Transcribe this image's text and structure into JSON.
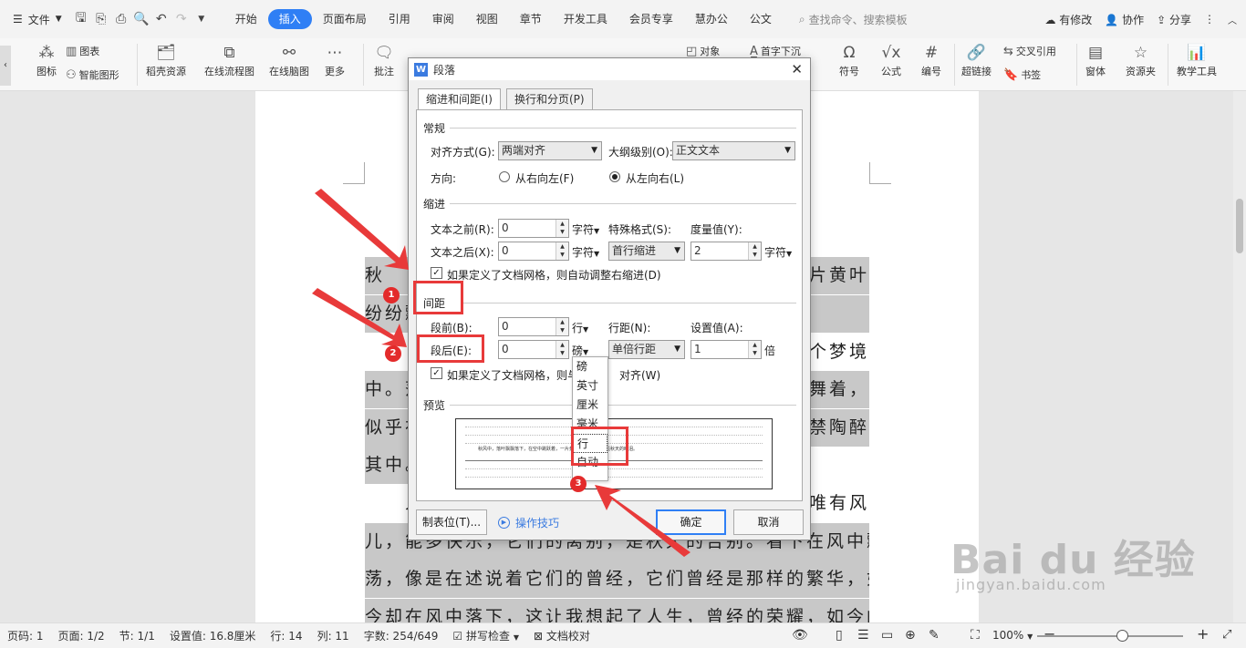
{
  "menubar": {
    "file": "文件",
    "tabs": [
      "开始",
      "插入",
      "页面布局",
      "引用",
      "审阅",
      "视图",
      "章节",
      "开发工具",
      "会员专享",
      "慧办公",
      "公文"
    ],
    "active_tab": "插入",
    "search": "查找命令、搜索模板",
    "right": {
      "revise": "有修改",
      "collab": "协作",
      "share": "分享"
    }
  },
  "ribbon": {
    "chart": "图表",
    "icon": "图标",
    "smart_graphic": "智能图形",
    "shell_resources": "稻壳资源",
    "online_flowchart": "在线流程图",
    "online_mindmap": "在线脑图",
    "more": "更多",
    "comment": "批注",
    "object": "对象",
    "dropcap": "首字下沉",
    "symbol": "符号",
    "formula": "公式",
    "numbering": "编号",
    "hyperlink": "超链接",
    "cross_ref": "交叉引用",
    "bookmark": "书签",
    "window": "窗体",
    "resource_folder": "资源夹",
    "teaching_tools": "教学工具"
  },
  "document": {
    "lines": [
      {
        "left": "秋",
        "right": "片黄叶"
      },
      {
        "left": "纷纷飘",
        "right": ""
      },
      {
        "left": "",
        "right": "个梦境"
      },
      {
        "left": "中。落",
        "right": "飞舞着，"
      },
      {
        "left": "似乎在",
        "right": "禁陶醉"
      },
      {
        "left": "其中。",
        "right": ""
      },
      {
        "left": "　　人",
        "right": "唯有风"
      },
      {
        "left": "儿，能多快乐，它们的离别，是秋天的告别。看下在风中飘",
        "right": ""
      },
      {
        "left": "荡，像是在述说着它们的曾经，它们曾经是那样的繁华，如",
        "right": ""
      },
      {
        "left": "今却在风中落下，这让我想起了人生，曾经的荣耀，如今的",
        "right": ""
      }
    ]
  },
  "dialog": {
    "title": "段落",
    "tabs": [
      "缩进和间距(I)",
      "换行和分页(P)"
    ],
    "general": {
      "section": "常规",
      "align_label": "对齐方式(G):",
      "align_value": "两端对齐",
      "outline_label": "大纲级别(O):",
      "outline_value": "正文文本",
      "direction_label": "方向:",
      "rtl": "从右向左(F)",
      "ltr": "从左向右(L)"
    },
    "indent": {
      "section": "缩进",
      "before_label": "文本之前(R):",
      "before_value": "0",
      "before_unit": "字符",
      "after_label": "文本之后(X):",
      "after_value": "0",
      "after_unit": "字符",
      "special_label": "特殊格式(S):",
      "special_value": "首行缩进",
      "measure_label": "度量值(Y):",
      "measure_value": "2",
      "measure_unit": "字符",
      "auto_adjust": "如果定义了文档网格，则自动调整右缩进(D)"
    },
    "spacing": {
      "section": "间距",
      "before_label": "段前(B):",
      "before_value": "0",
      "before_unit": "行",
      "after_label": "段后(E):",
      "after_value": "0",
      "after_unit": "磅",
      "line_label": "行距(N):",
      "line_value": "单倍行距",
      "setting_label": "设置值(A):",
      "setting_value": "1",
      "setting_unit": "倍",
      "grid_align_a": "如果定义了文档网格，则与",
      "grid_align_b": "对齐(W)"
    },
    "preview": {
      "section": "预览",
      "sample": "秋风中，落叶飘飘落下，在空中跳跃着，一片黄叶纷纷飘落，像是秋天的眼泪。"
    },
    "buttons": {
      "tabs": "制表位(T)...",
      "tips": "操作技巧",
      "ok": "确定",
      "cancel": "取消"
    }
  },
  "unit_menu": [
    "磅",
    "英寸",
    "厘米",
    "毫米",
    "行",
    "自动"
  ],
  "annotations": [
    "1",
    "2",
    "3"
  ],
  "watermark": {
    "brand": "Bai du 经验",
    "url": "jingyan.baidu.com"
  },
  "statusbar": {
    "page_no": "页码: 1",
    "pages": "页面: 1/2",
    "section": "节: 1/1",
    "setting": "设置值: 16.8厘米",
    "row": "行: 14",
    "col": "列: 11",
    "words": "字数: 254/649",
    "spell": "拼写检查",
    "proof": "文档校对",
    "zoom": "100%"
  },
  "colors": {
    "accent": "#2f7ff5",
    "annotation_red": "#e32b2b"
  }
}
